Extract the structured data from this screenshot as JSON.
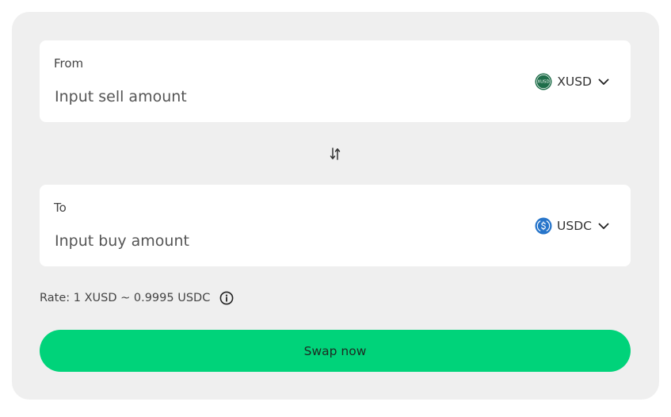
{
  "from": {
    "label": "From",
    "placeholder": "Input sell amount",
    "value": "",
    "token": {
      "symbol": "XUSD",
      "icon": "xusd-token-icon",
      "icon_text": "XUSD",
      "color": "#1f6e4a"
    }
  },
  "swap_direction": {
    "icon": "swap-vertical-arrows-icon"
  },
  "to": {
    "label": "To",
    "placeholder": "Input buy amount",
    "value": "",
    "token": {
      "symbol": "USDC",
      "icon": "usdc-token-icon",
      "color": "#2775ca"
    }
  },
  "rate": {
    "text": "Rate: 1 XUSD ~ 0.9995 USDC",
    "info_icon": "info-circle-icon"
  },
  "action": {
    "label": "Swap now",
    "color": "#00d37a"
  },
  "colors": {
    "panel_background": "#efefef",
    "card_background": "#ffffff",
    "text": "#333333"
  }
}
